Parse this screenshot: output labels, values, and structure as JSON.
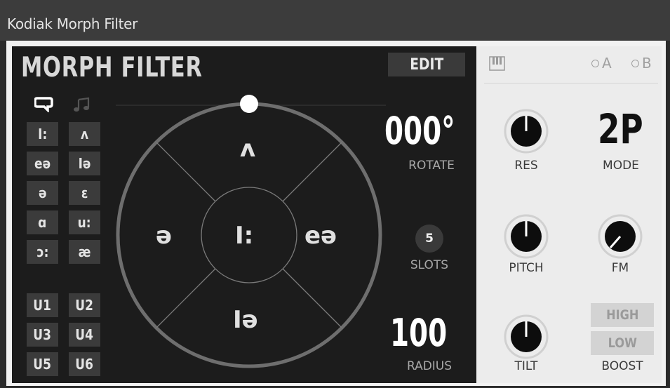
{
  "window": {
    "title": "Kodiak Morph Filter"
  },
  "panel": {
    "title": "MORPH FILTER",
    "edit_label": "EDIT",
    "mode_icons": [
      "speech-bubble-icon",
      "music-note-icon"
    ]
  },
  "vowel_grid": [
    [
      "I:",
      "ʌ"
    ],
    [
      "eə",
      "Iə"
    ],
    [
      "ə",
      "ɛ"
    ],
    [
      "ɑ",
      "u:"
    ],
    [
      "ɔ:",
      "æ"
    ]
  ],
  "user_grid": [
    [
      "U1",
      "U2"
    ],
    [
      "U3",
      "U4"
    ],
    [
      "U5",
      "U6"
    ]
  ],
  "morph_circle": {
    "top": "ʌ",
    "left": "ə",
    "center": "I:",
    "right": "eə",
    "bottom": "Iə"
  },
  "rotate": {
    "value": "000°",
    "label": "ROTATE"
  },
  "slots": {
    "value": "5",
    "label": "SLOTS"
  },
  "radius": {
    "value": "100",
    "label": "RADIUS"
  },
  "right_panel": {
    "keyboard_icon": "piano-keys-icon",
    "a_label": "A",
    "b_label": "B",
    "res_label": "RES",
    "mode_value": "2P",
    "mode_label": "MODE",
    "pitch_label": "PITCH",
    "fm_label": "FM",
    "tilt_label": "TILT",
    "boost_high": "HIGH",
    "boost_low": "LOW",
    "boost_label": "BOOST"
  },
  "colors": {
    "dark_panel": "#1c1c1c",
    "light_panel": "#ececec",
    "accent": "#ffffff"
  }
}
